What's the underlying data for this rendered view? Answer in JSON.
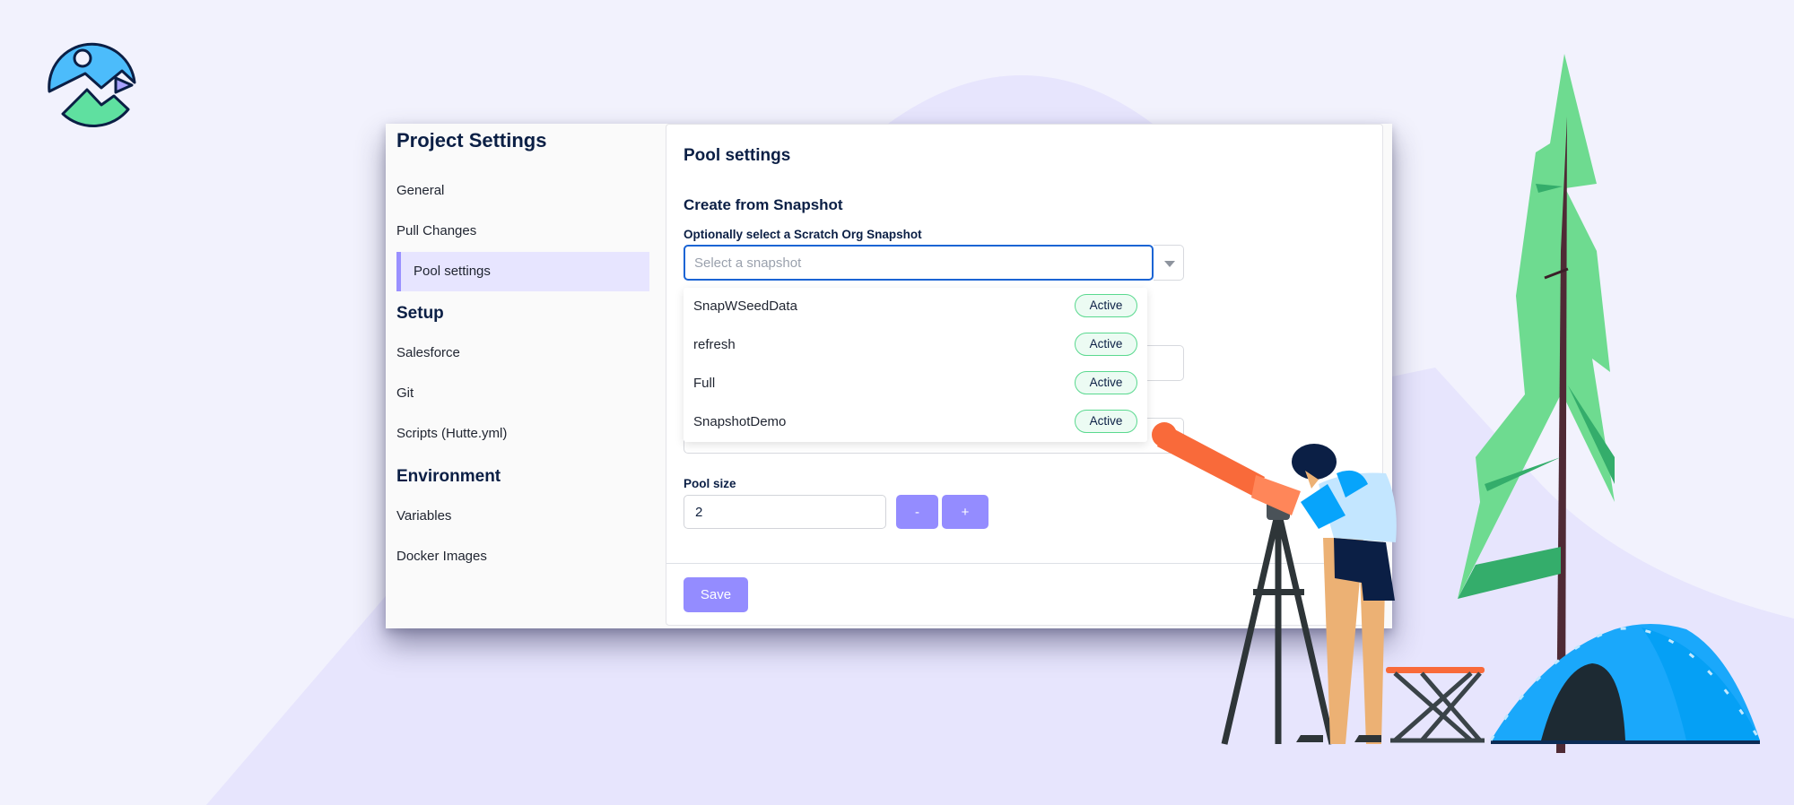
{
  "colors": {
    "background": "#f2f2fd",
    "background_shape": "#e7e5fd",
    "accent": "#948cff",
    "active_nav_bg": "#e7e5ff",
    "active_nav_bar": "#9a90ff",
    "focus_border": "#1b64d4",
    "badge_border": "#5ad98f",
    "badge_bg": "#ecfbf3",
    "heading_text": "#0b1f45"
  },
  "logo": {
    "icon": "mountain-sun-flag-logo-icon"
  },
  "sidebar": {
    "title": "Project Settings",
    "sections": [
      {
        "heading": null,
        "items": [
          {
            "label": "General",
            "active": false
          },
          {
            "label": "Pull Changes",
            "active": false
          },
          {
            "label": "Pool settings",
            "active": true
          }
        ]
      },
      {
        "heading": "Setup",
        "items": [
          {
            "label": "Salesforce",
            "active": false
          },
          {
            "label": "Git",
            "active": false
          },
          {
            "label": "Scripts (Hutte.yml)",
            "active": false
          }
        ]
      },
      {
        "heading": "Environment",
        "items": [
          {
            "label": "Variables",
            "active": false
          },
          {
            "label": "Docker Images",
            "active": false
          }
        ]
      }
    ]
  },
  "main": {
    "title": "Pool settings",
    "snapshot_section": {
      "title": "Create from Snapshot",
      "field_label": "Optionally select a Scratch Org Snapshot",
      "input_value": "",
      "input_placeholder": "Select a snapshot",
      "toggle_icon": "caret-down-icon",
      "options": [
        {
          "name": "SnapWSeedData",
          "status": "Active"
        },
        {
          "name": "refresh",
          "status": "Active"
        },
        {
          "name": "Full",
          "status": "Active"
        },
        {
          "name": "SnapshotDemo",
          "status": "Active"
        }
      ]
    },
    "pool_size": {
      "label": "Pool size",
      "value": "2",
      "decrement_label": "-",
      "increment_label": "+"
    },
    "save_label": "Save"
  },
  "illustration": {
    "description": "Person looking through a telescope beside a folding stool, pine tree and camping tent"
  }
}
